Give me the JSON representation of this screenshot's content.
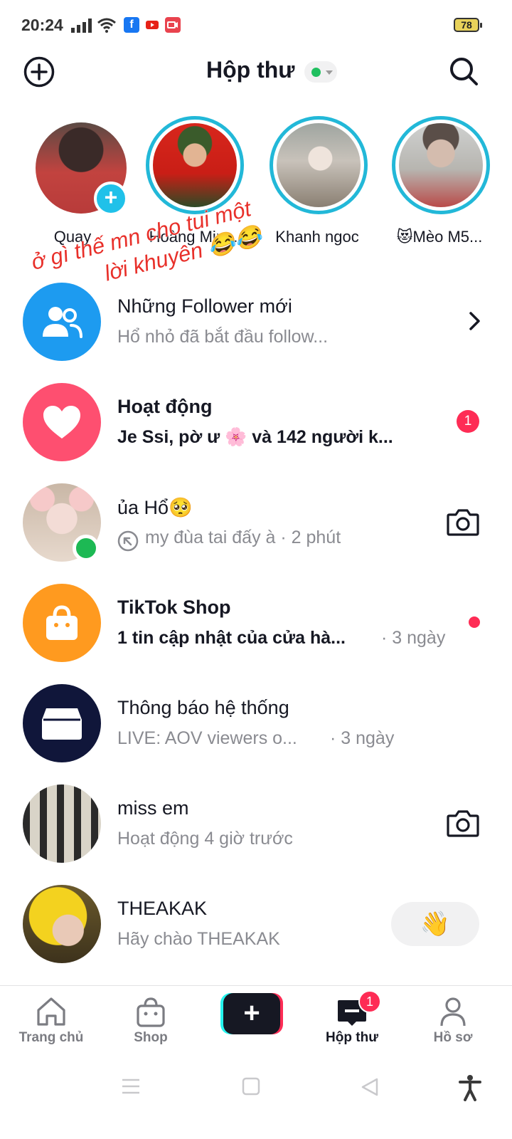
{
  "status_bar": {
    "time": "20:24",
    "battery": "78"
  },
  "header": {
    "title": "Hộp thư"
  },
  "stories": [
    {
      "name": "Quay"
    },
    {
      "name": "Hoàng Min..."
    },
    {
      "name": "Khanh ngoc"
    },
    {
      "name": "😻Mèo M5..."
    }
  ],
  "overlay": {
    "line1": "ở gì thế mn cho tui một",
    "line2": "lời khuyên",
    "emoji": "😂😂"
  },
  "rows": [
    {
      "title": "Những Follower mới",
      "subtitle": "Hổ nhỏ đã bắt đầu follow..."
    },
    {
      "title": "Hoạt động",
      "subtitle": "Je Ssi, pờ ư 🌸 và 142 người k...",
      "badge": "1"
    },
    {
      "title": "ủa Hổ🥺",
      "subtitle": "my đùa tai đấy à · 2 phút"
    },
    {
      "title": "TikTok Shop",
      "subtitle": "1 tin cập nhật của cửa hà...",
      "time": "· 3 ngày"
    },
    {
      "title": "Thông báo hệ thống",
      "subtitle": "LIVE: AOV viewers o...",
      "time": "· 3 ngày"
    },
    {
      "title": "miss em",
      "subtitle": "Hoạt động 4 giờ trước"
    },
    {
      "title": "THEAKAK",
      "subtitle": "Hãy chào THEAKAK",
      "action": "👋"
    }
  ],
  "tabs": [
    {
      "label": "Trang chủ"
    },
    {
      "label": "Shop"
    },
    {
      "label": ""
    },
    {
      "label": "Hộp thư",
      "badge": "1"
    },
    {
      "label": "Hồ sơ"
    }
  ],
  "colors": {
    "accent_red": "#fe2c55",
    "story_ring": "#22b8d8",
    "online": "#1db954",
    "follower_blue": "#1d9bf0",
    "activity_pink": "#fe4f70",
    "shop_orange": "#ff9a1f",
    "system_navy": "#10163a"
  }
}
